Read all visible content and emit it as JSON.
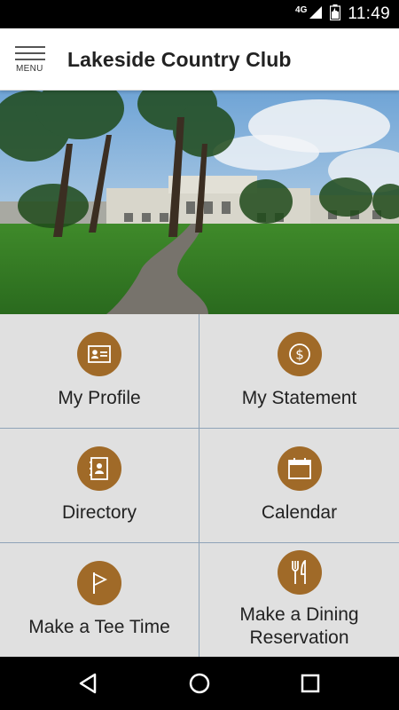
{
  "status_bar": {
    "network": "4G",
    "time": "11:49"
  },
  "app_bar": {
    "menu_label": "MENU",
    "title": "Lakeside Country Club"
  },
  "colors": {
    "accent": "#a06a28",
    "tile_bg": "#e0e0e0",
    "divider": "#8fa3b8"
  },
  "tiles": [
    {
      "label": "My Profile",
      "icon": "id-card-icon"
    },
    {
      "label": "My Statement",
      "icon": "dollar-icon"
    },
    {
      "label": "Directory",
      "icon": "address-book-icon"
    },
    {
      "label": "Calendar",
      "icon": "calendar-icon"
    },
    {
      "label": "Make a Tee Time",
      "icon": "golf-flag-icon"
    },
    {
      "label": "Make a Dining Reservation",
      "icon": "fork-knife-icon"
    }
  ]
}
